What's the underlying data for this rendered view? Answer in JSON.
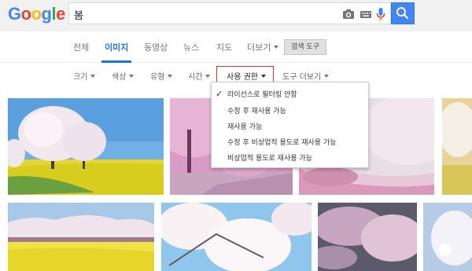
{
  "logo": {
    "letters": [
      "G",
      "o",
      "o",
      "g",
      "l",
      "e"
    ],
    "colors": [
      "#4285f4",
      "#ea4335",
      "#fbbc05",
      "#4285f4",
      "#34a853",
      "#ea4335"
    ]
  },
  "search": {
    "query": "봄"
  },
  "tabs": [
    {
      "label": "전체",
      "active": false
    },
    {
      "label": "이미지",
      "active": true
    },
    {
      "label": "동영상",
      "active": false
    },
    {
      "label": "뉴스",
      "active": false
    },
    {
      "label": "지도",
      "active": false
    },
    {
      "label": "더보기",
      "active": false,
      "dropdown": true
    }
  ],
  "tools_button": "검색 도구",
  "filters": [
    {
      "label": "크기"
    },
    {
      "label": "색상"
    },
    {
      "label": "유형"
    },
    {
      "label": "시간"
    },
    {
      "label": "사용 권한"
    },
    {
      "label": "도구 더보기"
    }
  ],
  "usage_rights_menu": [
    {
      "label": "라이선스로 필터링 안함",
      "checked": true
    },
    {
      "label": "수정 후 재사용 가능",
      "checked": false
    },
    {
      "label": "재사용 가능",
      "checked": false
    },
    {
      "label": "수정 후 비상업적 용도로 재사용 가능",
      "checked": false
    },
    {
      "label": "비상업적 용도로 재사용 가능",
      "checked": false
    }
  ],
  "colors": {
    "accent": "#1a73e8",
    "search_button": "#4285f4",
    "active_filter_border": "#d93025"
  }
}
